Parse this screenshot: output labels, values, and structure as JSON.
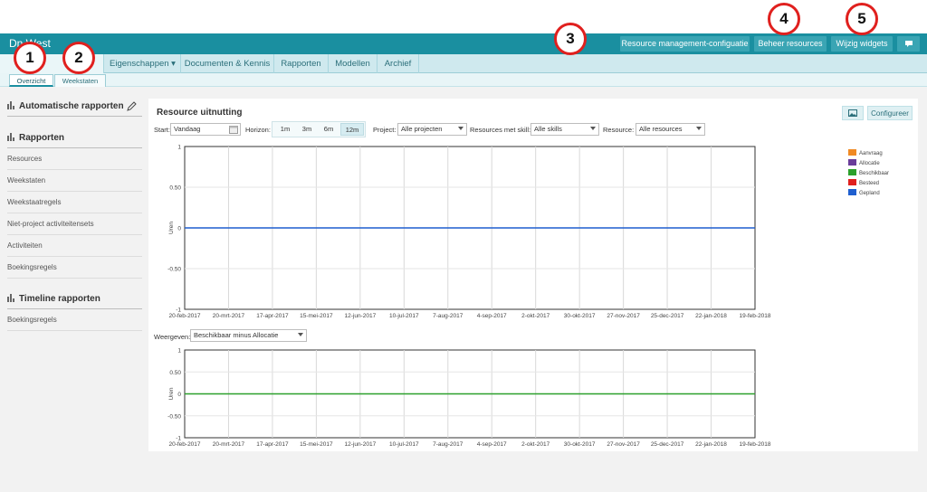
{
  "header": {
    "app_title": "Dn        West",
    "buttons": [
      "Resource management-configuatie",
      "Beheer resources",
      "Wijzig widgets"
    ],
    "chat_icon": "chat-icon"
  },
  "nav": {
    "items": [
      {
        "label": "Ma"
      },
      {
        "label": "Eigenschappen ▾"
      },
      {
        "label": "Documenten & Kennis"
      },
      {
        "label": "Rapporten"
      },
      {
        "label": "Modellen"
      },
      {
        "label": "Archief"
      }
    ],
    "subtabs": [
      "Overzicht",
      "Weekstaten"
    ]
  },
  "sidebar": {
    "section1": "Automatische rapporten",
    "section2": "Rapporten",
    "links": [
      "Resources",
      "Weekstaten",
      "Weekstaatregels",
      "Niet-project activiteitensets",
      "Activiteiten",
      "Boekingsregels"
    ],
    "section3": "Timeline rapporten",
    "links3": [
      "Boekingsregels"
    ]
  },
  "widget": {
    "title": "Resource uitnutting",
    "configure_label": "Configureer",
    "start_label": "Start:",
    "start_value": "Vandaag",
    "horizon_label": "Horizon:",
    "horizon_options": [
      "1m",
      "3m",
      "6m",
      "12m"
    ],
    "horizon_selected": "12m",
    "project_label": "Project:",
    "project_value": "Alle projecten",
    "skill_label": "Resources met skill:",
    "skill_value": "Alle skills",
    "resource_label": "Resource:",
    "resource_value": "Alle resources",
    "weergeven_label": "Weergeven:",
    "weergeven_value": "Beschikbaar minus Allocatie"
  },
  "legend": [
    {
      "name": "Aanvraag",
      "color": "#f08a24"
    },
    {
      "name": "Allocatie",
      "color": "#6a3d9a"
    },
    {
      "name": "Beschikbaar",
      "color": "#2ca02c"
    },
    {
      "name": "Besteed",
      "color": "#e0201e"
    },
    {
      "name": "Gepland",
      "color": "#1f5fcf"
    }
  ],
  "chart_data": [
    {
      "type": "line",
      "x": [
        "20-feb-2017",
        "20-mrt-2017",
        "17-apr-2017",
        "15-mei-2017",
        "12-jun-2017",
        "10-jul-2017",
        "7-aug-2017",
        "4-sep-2017",
        "2-okt-2017",
        "30-okt-2017",
        "27-nov-2017",
        "25-dec-2017",
        "22-jan-2018",
        "19-feb-2018"
      ],
      "yticks": [
        "1",
        "0.50",
        "0",
        "-0.50",
        "-1"
      ],
      "ylim": [
        -1,
        1
      ],
      "ylabel": "Uren",
      "series": [
        {
          "name": "Gepland",
          "color": "#1f5fcf",
          "values": [
            0,
            0,
            0,
            0,
            0,
            0,
            0,
            0,
            0,
            0,
            0,
            0,
            0,
            0
          ]
        }
      ],
      "grid": true
    },
    {
      "type": "line",
      "x": [
        "20-feb-2017",
        "20-mrt-2017",
        "17-apr-2017",
        "15-mei-2017",
        "12-jun-2017",
        "10-jul-2017",
        "7-aug-2017",
        "4-sep-2017",
        "2-okt-2017",
        "30-okt-2017",
        "27-nov-2017",
        "25-dec-2017",
        "22-jan-2018",
        "19-feb-2018"
      ],
      "yticks": [
        "1",
        "0.50",
        "0",
        "-0.50",
        "-1"
      ],
      "ylim": [
        -1,
        1
      ],
      "ylabel": "Uren",
      "series": [
        {
          "color": "#2ca02c",
          "values": [
            0,
            0,
            0,
            0,
            0,
            0,
            0,
            0,
            0,
            0,
            0,
            0,
            0,
            0
          ]
        }
      ],
      "grid": true
    }
  ],
  "markers": [
    "1",
    "2",
    "3",
    "4",
    "5"
  ]
}
